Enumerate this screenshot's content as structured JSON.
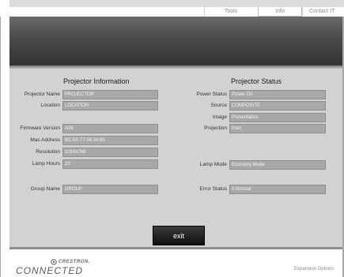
{
  "nav": {
    "tools": "Tools",
    "info": "Info",
    "contact": "Contact IT Help"
  },
  "info_section": {
    "title": "Projector Information",
    "fields": [
      {
        "label": "Projector Name",
        "value": "PROJECTOR"
      },
      {
        "label": "Location",
        "value": "LOCATION"
      },
      {
        "label": "Firmware Version",
        "value": "A06"
      },
      {
        "label": "Mac Address",
        "value": "BC:9A:77:56:34:85"
      },
      {
        "label": "Resolution",
        "value": "1024x768"
      },
      {
        "label": "Lamp Hours",
        "value": "23"
      },
      {
        "label": "Group Name",
        "value": "GROUP"
      }
    ]
  },
  "status_section": {
    "title": "Projector Status",
    "fields": [
      {
        "label": "Power Status",
        "value": "Power On"
      },
      {
        "label": "Source",
        "value": "COMPOSITE"
      },
      {
        "label": "Image",
        "value": "Presentation"
      },
      {
        "label": "Projection",
        "value": "front"
      },
      {
        "label": "Lamp Mode",
        "value": "Economy Mode"
      },
      {
        "label": "Error Status",
        "value": "0:Normal"
      }
    ]
  },
  "exit_label": "exit",
  "footer": {
    "brand_top": "CRESTRON.",
    "brand_bottom": "CONNECTED",
    "expansion": "Expansion Options"
  }
}
